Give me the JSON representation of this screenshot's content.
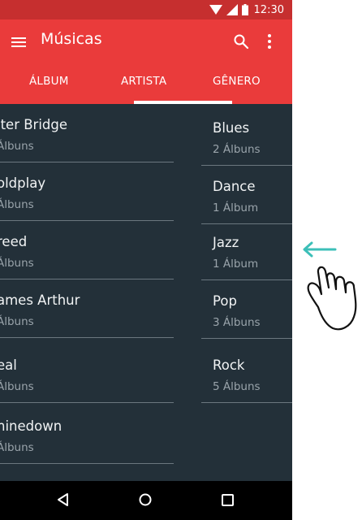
{
  "status_bar": {
    "time": "12:30"
  },
  "app_bar": {
    "title": "Músicas"
  },
  "tabs": [
    {
      "label": "ÁLBUM"
    },
    {
      "label": "ARTISTA"
    },
    {
      "label": "GÊNERO"
    }
  ],
  "artists": [
    {
      "name": "lter Bridge",
      "count": "Álbuns"
    },
    {
      "name": "oldplay",
      "count": "Álbuns"
    },
    {
      "name": "reed",
      "count": "Álbuns"
    },
    {
      "name": "ames Arthur",
      "count": "Álbuns"
    },
    {
      "name": "eal",
      "count": "Álbuns"
    },
    {
      "name": "hinedown",
      "count": "Álbuns"
    }
  ],
  "genres": [
    {
      "name": "Blues",
      "count": "2 Álbuns"
    },
    {
      "name": "Dance",
      "count": "1 Álbum"
    },
    {
      "name": "Jazz",
      "count": "1 Álbum"
    },
    {
      "name": "Pop",
      "count": "3 Álbuns"
    },
    {
      "name": "Rock",
      "count": "5 Álbuns"
    }
  ],
  "icons": {
    "menu": "menu-icon",
    "search": "search-icon",
    "more": "more-vert-icon",
    "back": "back-triangle-icon",
    "home": "home-circle-icon",
    "recents": "recents-square-icon",
    "gesture": "swipe-left-hand-icon"
  },
  "colors": {
    "status_bar": "#c62f2f",
    "app_bar": "#ea3b3b",
    "content_bg": "#233039",
    "gesture_arrow": "#3cbfb8"
  }
}
